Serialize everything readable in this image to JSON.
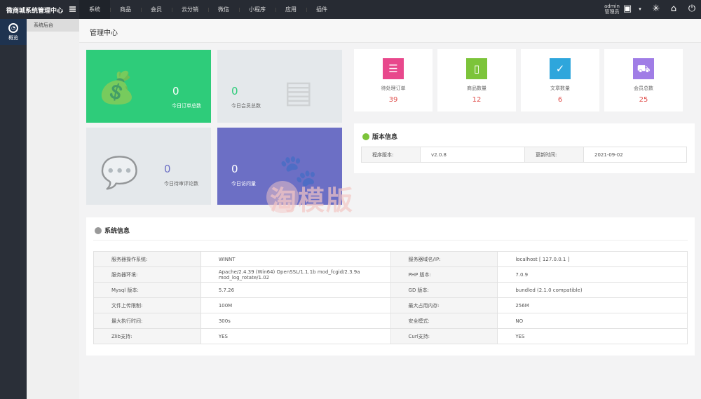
{
  "app": {
    "title": "微商城系统管理中心"
  },
  "nav": [
    "系统",
    "商品",
    "会员",
    "云分销",
    "微信",
    "小程序",
    "应用",
    "插件"
  ],
  "user": {
    "name": "admin",
    "role": "管理员"
  },
  "sidebar": {
    "active_label": "概览",
    "sub_items": [
      "系统后台"
    ]
  },
  "page_title": "管理中心",
  "tiles": [
    {
      "value": "0",
      "label": "今日订单总数",
      "color": "#2ecc7a"
    },
    {
      "value": "0",
      "label": "今日会员总数",
      "color": "#e4e8eb"
    },
    {
      "value": "0",
      "label": "今日待审评论数",
      "color": "#e4e8eb"
    },
    {
      "value": "0",
      "label": "今日访问量",
      "color": "#6c6fc5"
    }
  ],
  "stats": [
    {
      "label": "待处理订单",
      "value": "39",
      "color": "#e8488c"
    },
    {
      "label": "商品数量",
      "value": "12",
      "color": "#7cc43a"
    },
    {
      "label": "文章数量",
      "value": "6",
      "color": "#2ea6dc"
    },
    {
      "label": "会员总数",
      "value": "25",
      "color": "#a07de6"
    }
  ],
  "version": {
    "title": "版本信息",
    "rows": [
      [
        "程序版本:",
        "v2.0.8",
        "更新时间:",
        "2021-09-02"
      ]
    ]
  },
  "system": {
    "title": "系统信息",
    "rows": [
      [
        "服务器操作系统:",
        "WINNT",
        "服务器域名/IP:",
        "localhost [ 127.0.0.1 ]"
      ],
      [
        "服务器环境:",
        "Apache/2.4.39 (Win64) OpenSSL/1.1.1b mod_fcgid/2.3.9a mod_log_rotate/1.02",
        "PHP 版本:",
        "7.0.9"
      ],
      [
        "Mysql 版本:",
        "5.7.26",
        "GD 版本:",
        "bundled (2.1.0 compatible)"
      ],
      [
        "文件上传限制:",
        "100M",
        "最大占用内存:",
        "256M"
      ],
      [
        "最大执行时间:",
        "300s",
        "安全模式:",
        "NO"
      ],
      [
        "Zlib支持:",
        "YES",
        "Curl支持:",
        "YES"
      ]
    ]
  },
  "watermark": "淘模版"
}
